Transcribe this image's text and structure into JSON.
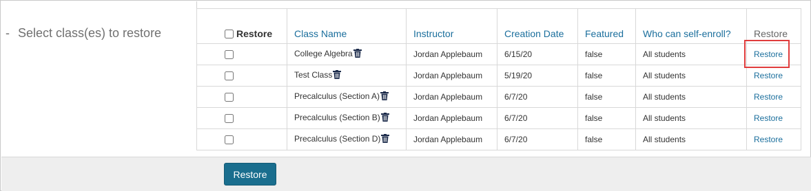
{
  "section": {
    "dash": "-",
    "title": "Select class(es) to restore"
  },
  "table": {
    "headers": {
      "select_all": "Restore",
      "class_name": "Class Name",
      "instructor": "Instructor",
      "creation_date": "Creation Date",
      "featured": "Featured",
      "who_can_enroll": "Who can self-enroll?",
      "action": "Restore"
    },
    "rows": [
      {
        "class_name": "College Algebra",
        "instructor": "Jordan Applebaum",
        "creation_date": "6/15/20",
        "featured": "false",
        "who_can_enroll": "All students",
        "action": "Restore"
      },
      {
        "class_name": "Test Class",
        "instructor": "Jordan Applebaum",
        "creation_date": "5/19/20",
        "featured": "false",
        "who_can_enroll": "All students",
        "action": "Restore"
      },
      {
        "class_name": "Precalculus (Section A)",
        "instructor": "Jordan Applebaum",
        "creation_date": "6/7/20",
        "featured": "false",
        "who_can_enroll": "All students",
        "action": "Restore"
      },
      {
        "class_name": "Precalculus (Section B)",
        "instructor": "Jordan Applebaum",
        "creation_date": "6/7/20",
        "featured": "false",
        "who_can_enroll": "All students",
        "action": "Restore"
      },
      {
        "class_name": "Precalculus (Section D)",
        "instructor": "Jordan Applebaum",
        "creation_date": "6/7/20",
        "featured": "false",
        "who_can_enroll": "All students",
        "action": "Restore"
      }
    ]
  },
  "footer": {
    "restore_button": "Restore"
  },
  "colors": {
    "link": "#1a6e9c",
    "button": "#1a6e8e",
    "highlight": "#e03c3c",
    "footer_bg": "#eeeeee"
  },
  "icons": {
    "trash": "trash-icon"
  }
}
